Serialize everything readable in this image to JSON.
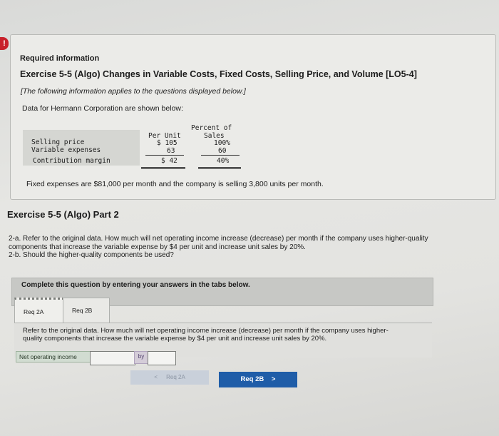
{
  "alert": "!",
  "info": {
    "heading": "Required information",
    "exercise_title": "Exercise 5-5 (Algo) Changes in Variable Costs, Fixed Costs, Selling Price, and Volume [LO5-4]",
    "note": "[The following information applies to the questions displayed below.]",
    "data_intro": "Data for Hermann Corporation are shown below:",
    "table": {
      "col_per_unit": "Per Unit",
      "col_percent_1": "Percent of",
      "col_percent_2": "Sales",
      "rows": [
        {
          "label": "Selling price",
          "per_unit": "$ 105",
          "percent": "100%"
        },
        {
          "label": "Variable expenses",
          "per_unit": "63",
          "percent": "60"
        },
        {
          "label": "Contribution margin",
          "per_unit": "$ 42",
          "percent": "40%"
        }
      ]
    },
    "fixed_expenses": "Fixed expenses are $81,000 per month and the company is selling 3,800 units per month."
  },
  "part_title": "Exercise 5-5 (Algo) Part 2",
  "question_lines": [
    "2-a. Refer to the original data. How much will net operating income increase (decrease) per month if the company uses higher-quality",
    "components that increase the variable expense by $4 per unit and increase unit sales by 20%.",
    "2-b. Should the higher-quality components be used?"
  ],
  "instructions": "Complete this question by entering your answers in the tabs below.",
  "tabs": [
    "Req 2A",
    "Req 2B"
  ],
  "tab_content_lines": [
    "Refer to the original data. How much will net operating income increase (decrease) per month if the company uses higher-",
    "quality components that increase the variable expense by $4 per unit and increase unit sales by 20%."
  ],
  "answer_row": {
    "label": "Net operating income",
    "value": "",
    "by_label": "by",
    "by_value": ""
  },
  "nav": {
    "prev": "Req 2A",
    "next": "Req 2B",
    "prev_arrow": "<",
    "next_arrow": ">"
  },
  "colors": {
    "next_button": "#1f5da8",
    "alert_badge": "#c8212b"
  }
}
